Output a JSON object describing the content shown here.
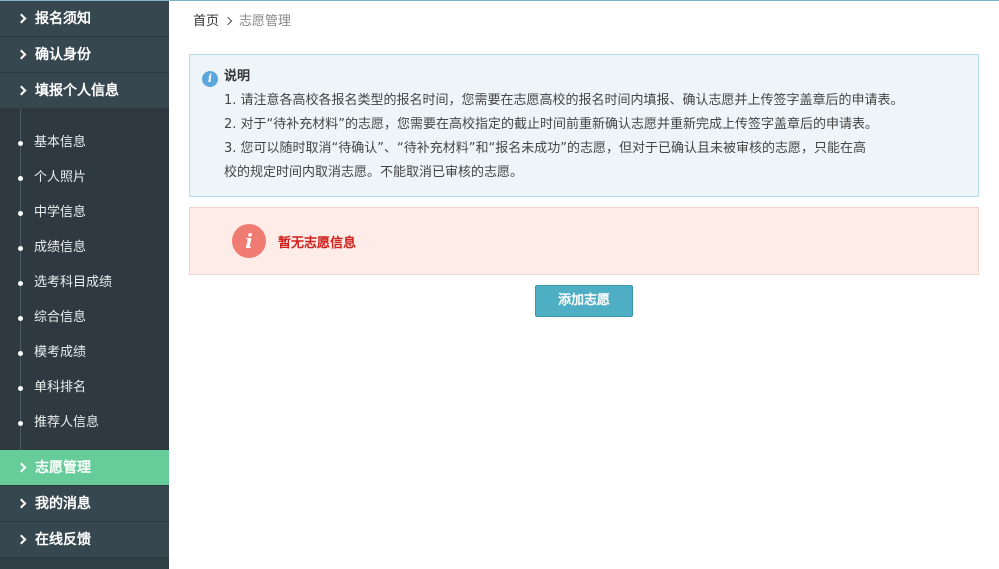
{
  "sidebar": {
    "top_items": [
      {
        "label": "报名须知"
      },
      {
        "label": "确认身份"
      },
      {
        "label": "填报个人信息"
      }
    ],
    "sub_items": [
      {
        "label": "基本信息"
      },
      {
        "label": "个人照片"
      },
      {
        "label": "中学信息"
      },
      {
        "label": "成绩信息"
      },
      {
        "label": "选考科目成绩"
      },
      {
        "label": "综合信息"
      },
      {
        "label": "模考成绩"
      },
      {
        "label": "单科排名"
      },
      {
        "label": "推荐人信息"
      }
    ],
    "bottom_items": [
      {
        "label": "志愿管理",
        "active": true
      },
      {
        "label": "我的消息"
      },
      {
        "label": "在线反馈"
      }
    ]
  },
  "breadcrumb": {
    "home": "首页",
    "current": "志愿管理"
  },
  "notice": {
    "title": "说明",
    "lines": [
      "1. 请注意各高校各报名类型的报名时间，您需要在志愿高校的报名时间内填报、确认志愿并上传签字盖章后的申请表。",
      "2. 对于“待补充材料”的志愿，您需要在高校指定的截止时间前重新确认志愿并重新完成上传签字盖章后的申请表。",
      "3. 您可以随时取消“待确认”、“待补充材料”和“报名未成功”的志愿，但对于已确认且未被审核的志愿，只能在高",
      "校的规定时间内取消志愿。不能取消已审核的志愿。"
    ]
  },
  "empty_message": "暂无志愿信息",
  "add_button_label": "添加志愿",
  "colors": {
    "sidebar_bg": "#37474f",
    "active_item": "#66cc99",
    "button": "#4eaec4",
    "error_text": "#d0201b"
  }
}
